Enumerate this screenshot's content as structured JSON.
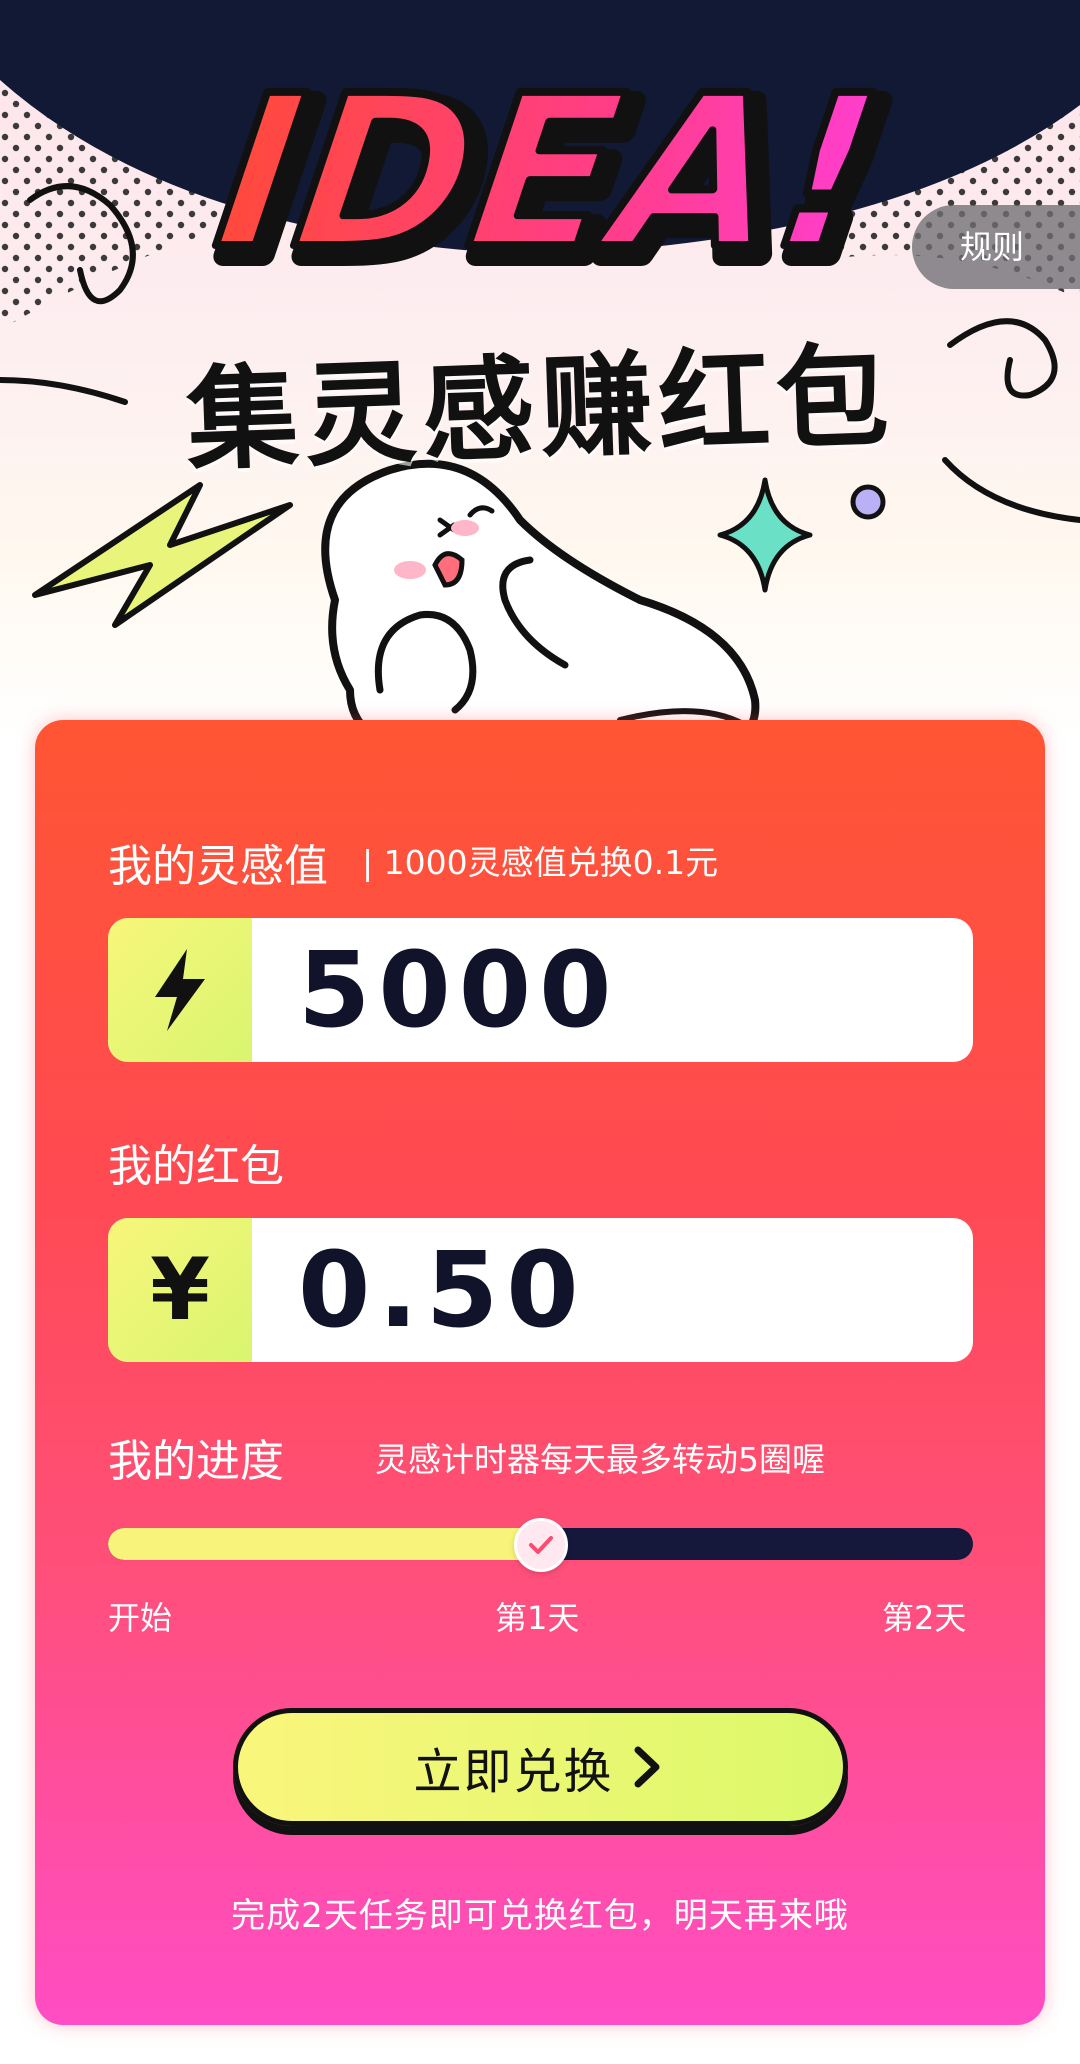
{
  "header": {
    "title_en": "IDEA!",
    "title_cn": "集灵感赚红包",
    "rules_label": "规则"
  },
  "points": {
    "label": "我的灵感值",
    "rate": "| 1000灵感值兑换0.1元",
    "value": "5000",
    "icon": "lightning-icon"
  },
  "redpacket": {
    "label": "我的红包",
    "currency": "¥",
    "value": "0.50"
  },
  "progress": {
    "label": "我的进度",
    "hint": "灵感计时器每天最多转动5圈喔",
    "fraction": 0.5,
    "ticks": [
      "开始",
      "第1天",
      "第2天"
    ]
  },
  "action": {
    "button_label": "立即兑换",
    "note": "完成2天任务即可兑换红包，明天再来哦"
  },
  "colors": {
    "card_top": "#ff5533",
    "card_bottom": "#ff4dc4",
    "accent_yellow": "#f8f67a",
    "dark_navy": "#15183a"
  }
}
